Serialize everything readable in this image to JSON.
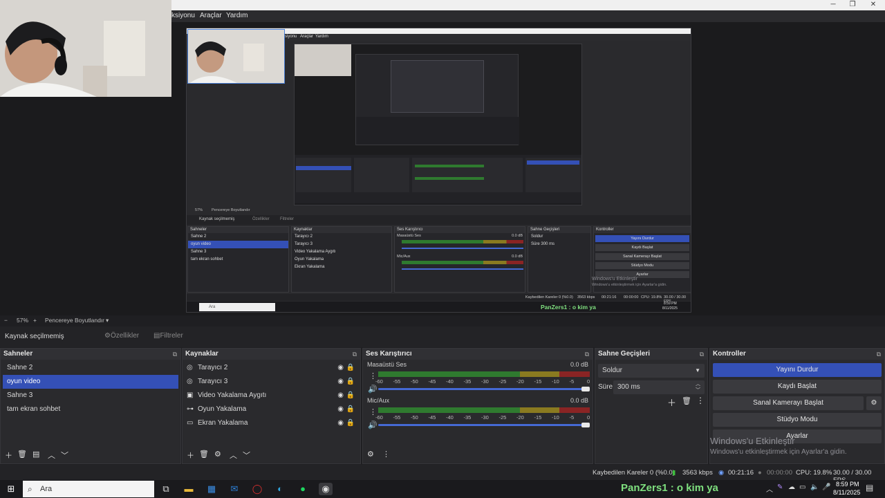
{
  "menu": {
    "items": [
      "ksiyonu",
      "Araçlar",
      "Yardım"
    ]
  },
  "preview": {
    "nested_menu": [
      "siyonu",
      "Araçlar",
      "Yardım"
    ],
    "nested_zoom": "57%",
    "nested_zoom_mode": "Pencereye Boyutlandır",
    "nested_source_status": "Kaynak seçilmemiş",
    "nested_props": "Özellikler",
    "nested_filters": "Filtreler",
    "nested_scenes_title": "Sahneler",
    "nested_scenes": [
      "Sahne 2",
      "oyun video",
      "Sahne 3",
      "tam ekran sohbet"
    ],
    "nested_sources_title": "Kaynaklar",
    "nested_sources": [
      "Tarayıcı 2",
      "Tarayıcı 3",
      "Video Yakalama Aygıtı",
      "Oyun Yakalama",
      "Ekran Yakalama"
    ],
    "nested_mixer_title": "Ses Karıştırıcı",
    "nested_mixer_ch1": "Masaüstü Ses",
    "nested_mixer_ch2": "Mic/Aux",
    "nested_mixer_db": "0.0 dB",
    "nested_trans_title": "Sahne Geçişleri",
    "nested_trans_value": "Soldur",
    "nested_trans_dur_label": "Süre",
    "nested_trans_dur": "300 ms",
    "nested_ctrl_title": "Kontroller",
    "nested_ctrls": [
      "Yayını Durdur",
      "Kaydı Başlat",
      "Sanal Kamerayı Başlat",
      "Stüdyo Modu",
      "Ayarlar"
    ],
    "nested_watermark1": "Windows'u Etkinleştir",
    "nested_watermark2": "Windows'u etkinleştirmek için Ayarlar'a gidin.",
    "nested_status": [
      "Kaybedilen Kareler 0 (%0.0)",
      "3563 kbps",
      "00:21:16",
      "00:00:00",
      "CPU: 19.8%",
      "30.00 / 30.00 FPS"
    ],
    "nested_search": "Ara",
    "nested_track": "PanZers1 : o kim ya",
    "nested_time": "8:59 PM",
    "nested_date": "8/11/2025"
  },
  "zoom": {
    "minus": "−",
    "value": "57%",
    "plus": "+",
    "mode": "Pencereye Boyutlandır",
    "chevron": "▾"
  },
  "source_bar": {
    "status": "Kaynak seçilmemiş",
    "properties": "Özellikler",
    "filters": "Filtreler"
  },
  "scenes": {
    "title": "Sahneler",
    "items": [
      "Sahne 2",
      "oyun video",
      "Sahne 3",
      "tam ekran sohbet"
    ],
    "selected": 1
  },
  "sources": {
    "title": "Kaynaklar",
    "items": [
      {
        "label": "Tarayıcı 2",
        "icon": "globe-icon"
      },
      {
        "label": "Tarayıcı 3",
        "icon": "globe-icon"
      },
      {
        "label": "Video Yakalama Aygıtı",
        "icon": "camera-icon"
      },
      {
        "label": "Oyun Yakalama",
        "icon": "gamepad-icon"
      },
      {
        "label": "Ekran Yakalama",
        "icon": "monitor-icon"
      }
    ]
  },
  "mixer": {
    "title": "Ses Karıştırıcı",
    "channels": [
      {
        "name": "Masaüstü Ses",
        "db": "0.0 dB"
      },
      {
        "name": "Mic/Aux",
        "db": "0.0 dB"
      }
    ],
    "ticks": [
      "-60",
      "-55",
      "-50",
      "-45",
      "-40",
      "-35",
      "-30",
      "-25",
      "-20",
      "-15",
      "-10",
      "-5",
      "0"
    ]
  },
  "transitions": {
    "title": "Sahne Geçişleri",
    "value": "Soldur",
    "duration_label": "Süre",
    "duration": "300 ms"
  },
  "controls": {
    "title": "Kontroller",
    "stop_stream": "Yayını Durdur",
    "start_record": "Kaydı Başlat",
    "start_vcam": "Sanal Kamerayı Başlat",
    "studio_mode": "Stüdyo Modu",
    "settings": "Ayarlar"
  },
  "watermark": {
    "line1": "Windows'u Etkinleştir",
    "line2": "Windows'u etkinleştirmek için Ayarlar'a gidin."
  },
  "status": {
    "dropped": "Kaybedilen Kareler 0 (%0.0)",
    "bitrate": "3563 kbps",
    "stream_time": "00:21:16",
    "record_time": "00:00:00",
    "cpu": "CPU: 19.8%",
    "fps": "30.00 / 30.00 FPS"
  },
  "taskbar": {
    "search_placeholder": "Ara",
    "now_playing": "PanZers1 : o kim ya",
    "time": "8:59 PM",
    "date": "8/11/2025"
  },
  "colors": {
    "accent": "#3450b6",
    "meter_green": "#2f7a2f",
    "meter_yellow": "#8a7a20",
    "meter_red": "#8a2424"
  }
}
